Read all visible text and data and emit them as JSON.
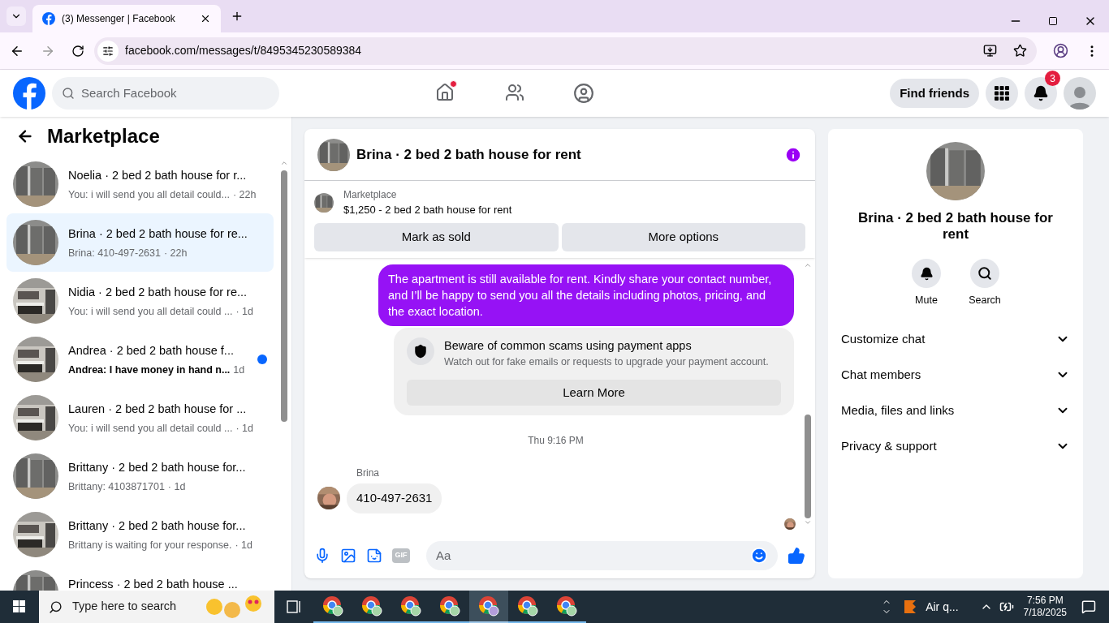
{
  "browser": {
    "tab": {
      "title": "(3) Messenger | Facebook",
      "selected": true
    },
    "url": "facebook.com/messages/t/8495345230589384"
  },
  "header": {
    "search_placeholder": "Search Facebook",
    "home_dot": true,
    "find_friends": "Find friends",
    "notifications": "3"
  },
  "sidebar": {
    "title": "Marketplace",
    "conversations": [
      {
        "name": "Noelia · 2 bed 2 bath house for r...",
        "preview": "You: i will send you all detail could...",
        "time": "· 22h",
        "selected": false,
        "unread": false
      },
      {
        "name": "Brina · 2 bed 2 bath house for re...",
        "preview": "Brina: 410-497-2631",
        "time": "· 22h",
        "selected": true,
        "unread": false
      },
      {
        "name": "Nidia · 2 bed 2 bath house for re...",
        "preview": "You: i will send you all detail could ...",
        "time": "· 1d",
        "selected": false,
        "unread": false
      },
      {
        "name": "Andrea · 2 bed 2 bath house f...",
        "preview": "Andrea: I have money in hand n...",
        "time": "1d",
        "selected": false,
        "unread": true
      },
      {
        "name": "Lauren · 2 bed 2 bath house for ...",
        "preview": "You: i will send you all detail could ...",
        "time": "· 1d",
        "selected": false,
        "unread": false
      },
      {
        "name": "Brittany · 2 bed 2 bath house for...",
        "preview": "Brittany: 4103871701",
        "time": "· 1d",
        "selected": false,
        "unread": false
      },
      {
        "name": "Brittany · 2 bed 2 bath house for...",
        "preview": "Brittany is waiting for your response.",
        "time": "· 1d",
        "selected": false,
        "unread": false
      },
      {
        "name": "Princess · 2 bed 2 bath house ...",
        "selected": false
      }
    ]
  },
  "chat": {
    "title": "Brina · 2 bed 2 bath house for rent",
    "listing": {
      "source": "Marketplace",
      "title": "$1,250 - 2 bed 2 bath house for rent"
    },
    "actions": [
      "Mark as sold",
      "More options"
    ],
    "messages": [
      {
        "kind": "outgoing",
        "text": "The apartment is still available for rent. Kindly share your contact number, and I’ll be happy to send you all the details including photos, pricing, and the exact location."
      },
      {
        "kind": "notice",
        "title": "Beware of common scams using payment apps",
        "body": "Watch out for fake emails or requests to upgrade your payment account.",
        "button": "Learn More"
      },
      {
        "kind": "timestamp",
        "text": "Thu 9:16 PM"
      },
      {
        "kind": "incoming",
        "sender": "Brina",
        "text": "410-497-2631"
      }
    ],
    "composer": {
      "gif_label": "GIF",
      "placeholder": "Aa"
    }
  },
  "details": {
    "title": "Brina · 2 bed 2 bath house for rent",
    "actions": [
      "Mute",
      "Search"
    ],
    "sections": [
      "Customize chat",
      "Chat members",
      "Media, files and links",
      "Privacy & support"
    ]
  },
  "taskbar": {
    "search_placeholder": "Type here to search",
    "apps": [
      {
        "selected": false
      },
      {
        "selected": false
      },
      {
        "selected": false
      },
      {
        "selected": false
      },
      {
        "selected": true
      },
      {
        "selected": false
      },
      {
        "selected": false
      }
    ],
    "weather": "Air q...",
    "time": "7:56 PM",
    "date": "7/18/2025"
  }
}
